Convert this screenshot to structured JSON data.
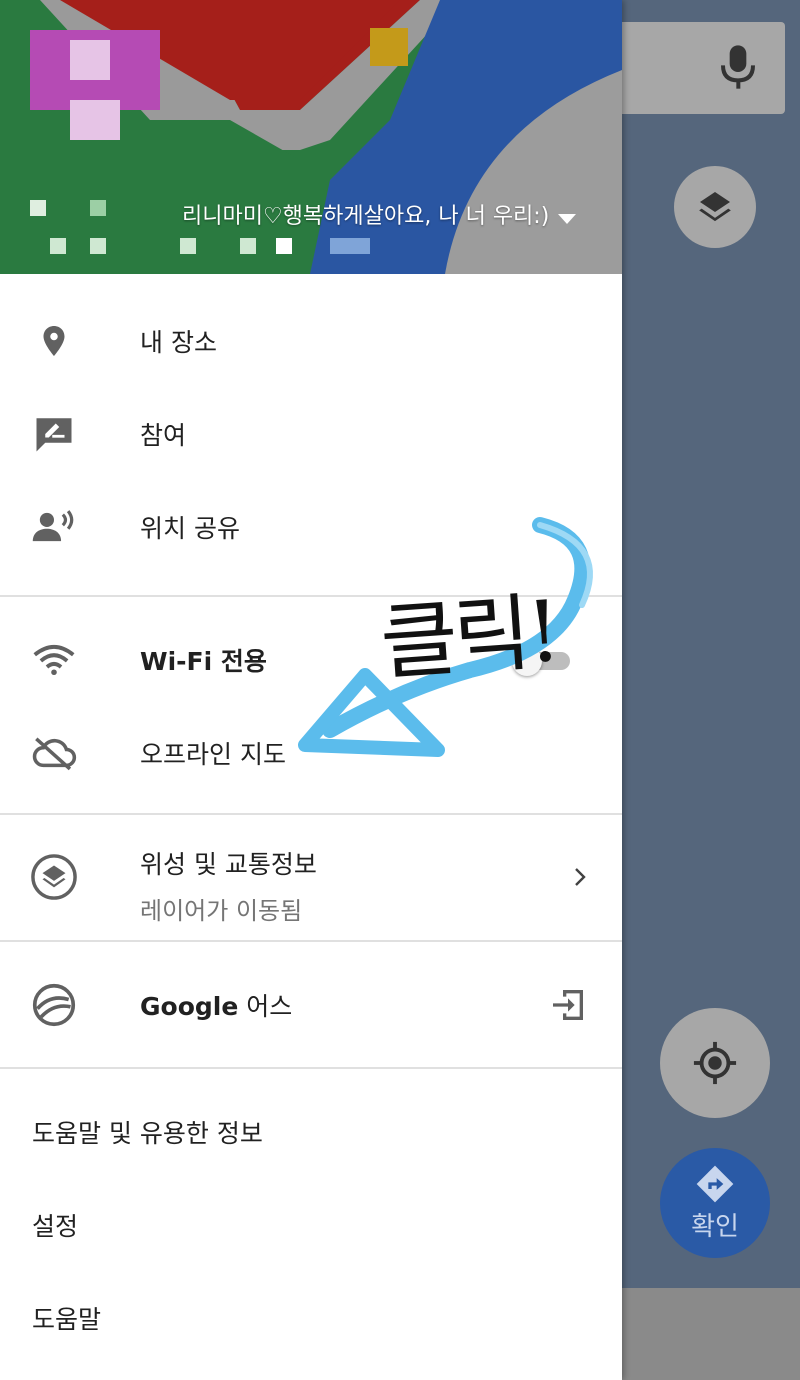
{
  "header": {
    "account_name": "리니마미♡행복하게살아요, 나 너 우리:)"
  },
  "menu": {
    "section1": [
      {
        "label": "내 장소",
        "icon": "place-pin-icon"
      },
      {
        "label": "참여",
        "icon": "contribute-icon"
      },
      {
        "label": "위치 공유",
        "icon": "location-sharing-icon"
      }
    ],
    "section2": [
      {
        "label": "Wi-Fi 전용",
        "icon": "wifi-icon",
        "toggle": false
      },
      {
        "label": "오프라인 지도",
        "icon": "offline-cloud-icon"
      }
    ],
    "layers": {
      "label": "위성 및 교통정보",
      "sublabel": "레이어가 이동됨",
      "icon": "layers-icon"
    },
    "earth": {
      "label_bold": "Google",
      "label_rest": " 어스",
      "icon": "google-earth-icon"
    },
    "plain": [
      "도움말 및 유용한 정보",
      "설정",
      "도움말"
    ]
  },
  "map": {
    "confirm_label": "확인"
  },
  "annotation": {
    "text": "클릭!"
  },
  "colors": {
    "drawer_bg": "#ffffff",
    "map_overlay": "#55667c",
    "confirm_fab": "#2a5aa6",
    "annotation_arrow": "#5bbcec"
  }
}
